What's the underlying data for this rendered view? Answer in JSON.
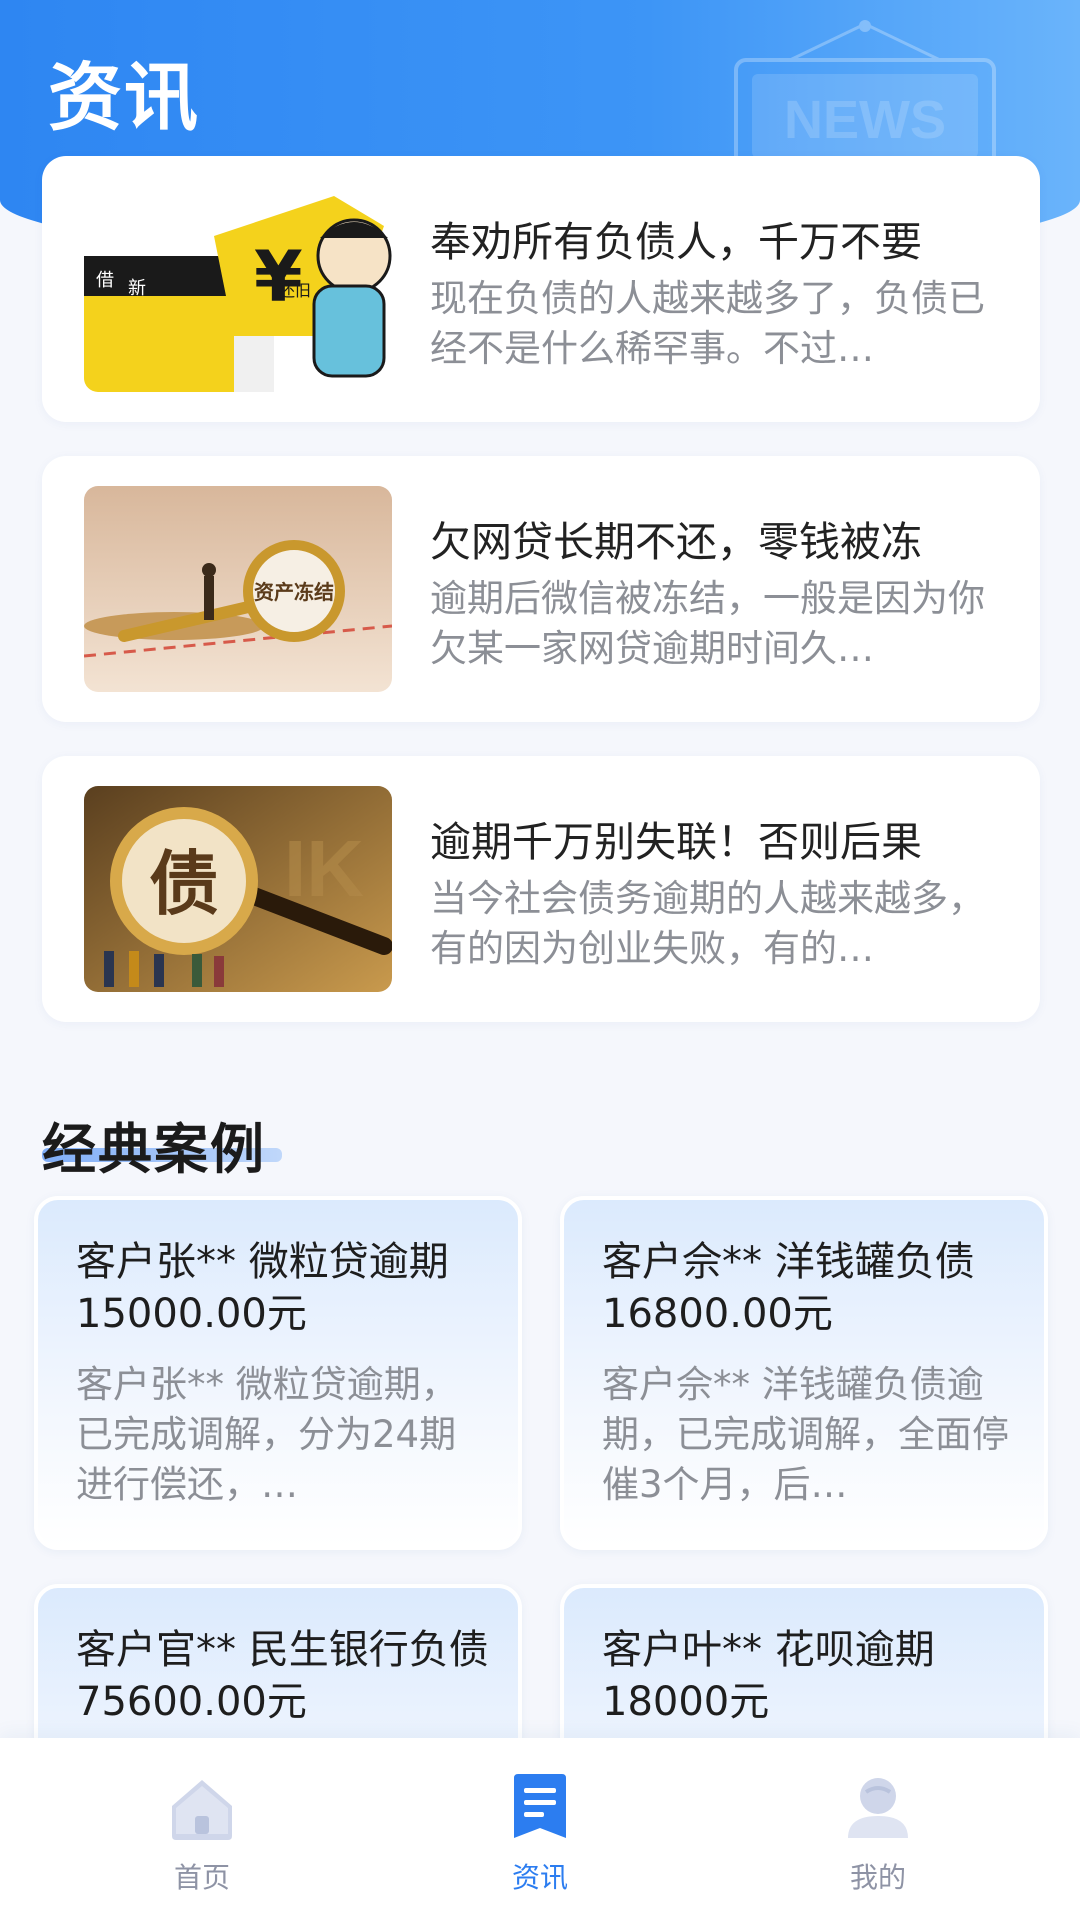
{
  "header": {
    "title": "资讯",
    "decoration_text": "NEWS"
  },
  "news": [
    {
      "title": "奉劝所有负债人，千万不要",
      "desc": "现在负债的人越来越多了，负债已经不是什么稀罕事。不过…",
      "thumb_text": [
        "借",
        "新",
        "还旧"
      ]
    },
    {
      "title": "欠网贷长期不还，零钱被冻",
      "desc": "逾期后微信被冻结，一般是因为你欠某一家网贷逾期时间久…",
      "thumb_text": [
        "资产冻结"
      ]
    },
    {
      "title": "逾期千万别失联！否则后果",
      "desc": "当今社会债务逾期的人越来越多，有的因为创业失败，有的…",
      "thumb_text": [
        "债"
      ]
    }
  ],
  "cases_section": {
    "title": "经典案例"
  },
  "cases": [
    {
      "title": "客户张** 微粒贷逾期15000.00元",
      "desc": "客户张** 微粒贷逾期，已完成调解，分为24期进行偿还，…"
    },
    {
      "title": "客户佘** 洋钱罐负债16800.00元",
      "desc": "客户佘** 洋钱罐负债逾期，已完成调解，全面停催3个月，后…"
    },
    {
      "title": "客户官** 民生银行负债75600.00元",
      "desc": ""
    },
    {
      "title": "客户叶** 花呗逾期18000元",
      "desc": ""
    }
  ],
  "tabbar": {
    "items": [
      {
        "label": "首页",
        "icon": "home-icon",
        "active": false
      },
      {
        "label": "资讯",
        "icon": "news-icon",
        "active": true
      },
      {
        "label": "我的",
        "icon": "user-icon",
        "active": false
      }
    ]
  },
  "colors": {
    "primary": "#2c7df0",
    "header_gradient_start": "#2e86f2",
    "header_gradient_end": "#6ab4fb",
    "text_muted": "#8c8f96",
    "tab_inactive": "#8e93a5"
  }
}
